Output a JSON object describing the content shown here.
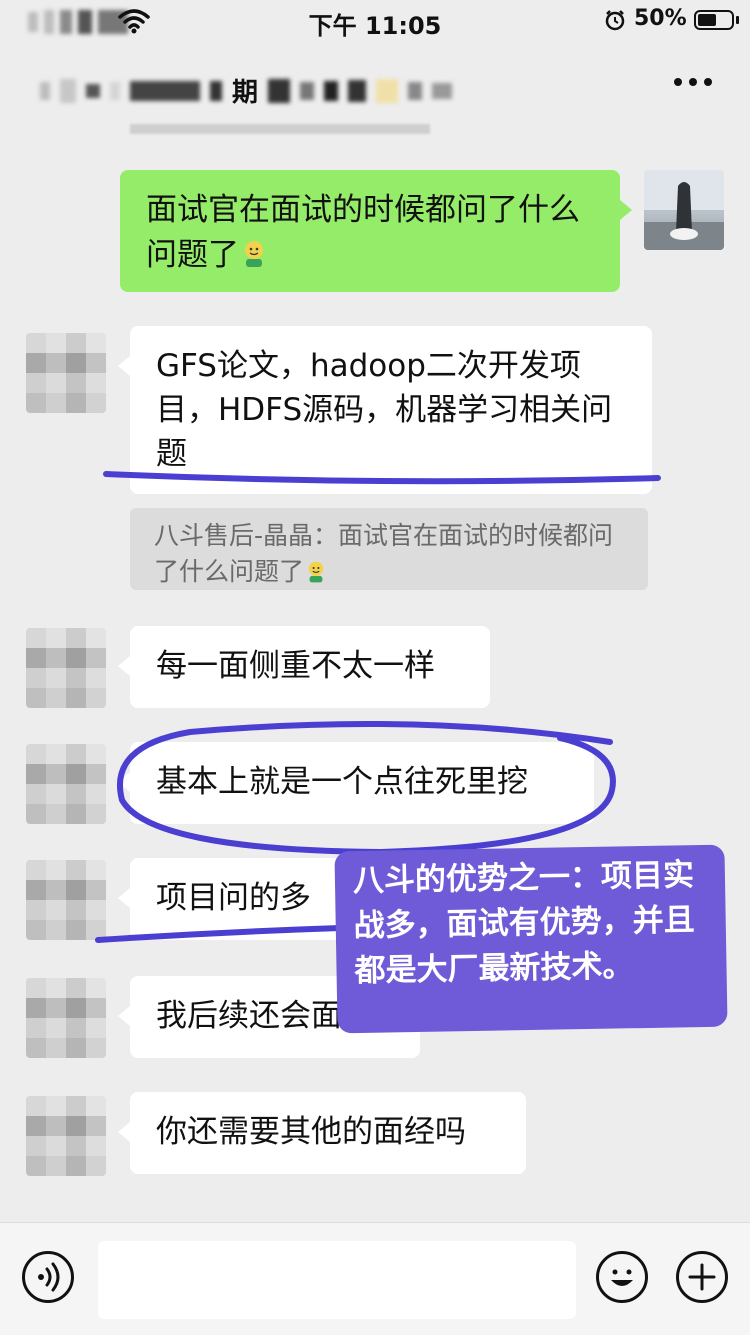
{
  "status_bar": {
    "time": "下午 11:05",
    "battery": "50%"
  },
  "nav": {
    "title_fragment": "期"
  },
  "messages": {
    "sent_1": "面试官在面试的时候都问了什么问题了",
    "recv_1": "GFS论文，hadoop二次开发项目，HDFS源码，机器学习相关问题",
    "quote_1": "八斗售后-晶晶：面试官在面试的时候都问了什么问题了",
    "recv_2": "每一面侧重不太一样",
    "recv_3": "基本上就是一个点往死里挖",
    "recv_4": "项目问的多",
    "recv_5": "我后续还会面们",
    "recv_6": "你还需要其他的面经吗"
  },
  "annotation": {
    "text": "八斗的优势之一：项目实战多，面试有优势，并且都是大厂最新技术。"
  },
  "icons": {
    "emoji_face": "smile-emoji",
    "annotation_color": "#6f5bd7"
  },
  "colors": {
    "sent_bubble": "#95ec69",
    "received_bubble": "#ffffff",
    "background": "#ededed",
    "ink": "#4a3fd0"
  }
}
